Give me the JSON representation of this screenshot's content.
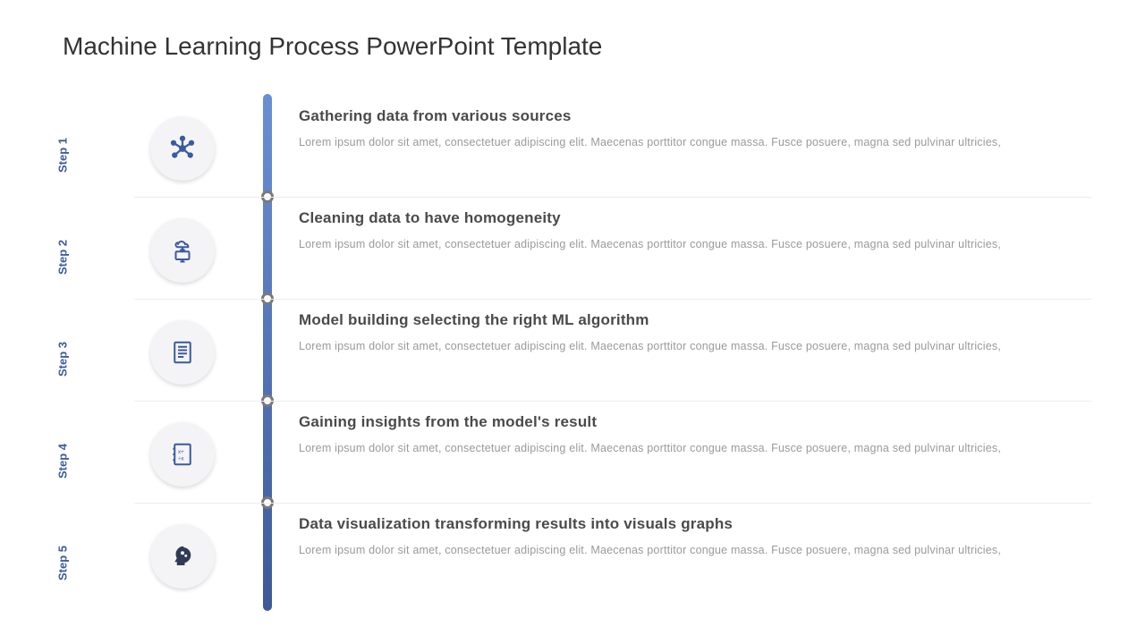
{
  "title": "Machine Learning Process PowerPoint Template",
  "lorem": "Lorem ipsum dolor sit amet, consectetuer adipiscing elit. Maecenas porttitor congue massa. Fusce posuere, magna sed pulvinar ultricies,",
  "steps": [
    {
      "label": "Step 1",
      "title": "Gathering data from various sources"
    },
    {
      "label": "Step 2",
      "title": "Cleaning data to have homogeneity"
    },
    {
      "label": "Step 3",
      "title": "Model building selecting the right ML algorithm"
    },
    {
      "label": "Step 4",
      "title": "Gaining insights from the model's result"
    },
    {
      "label": "Step 5",
      "title": "Data visualization transforming results into visuals graphs"
    }
  ]
}
